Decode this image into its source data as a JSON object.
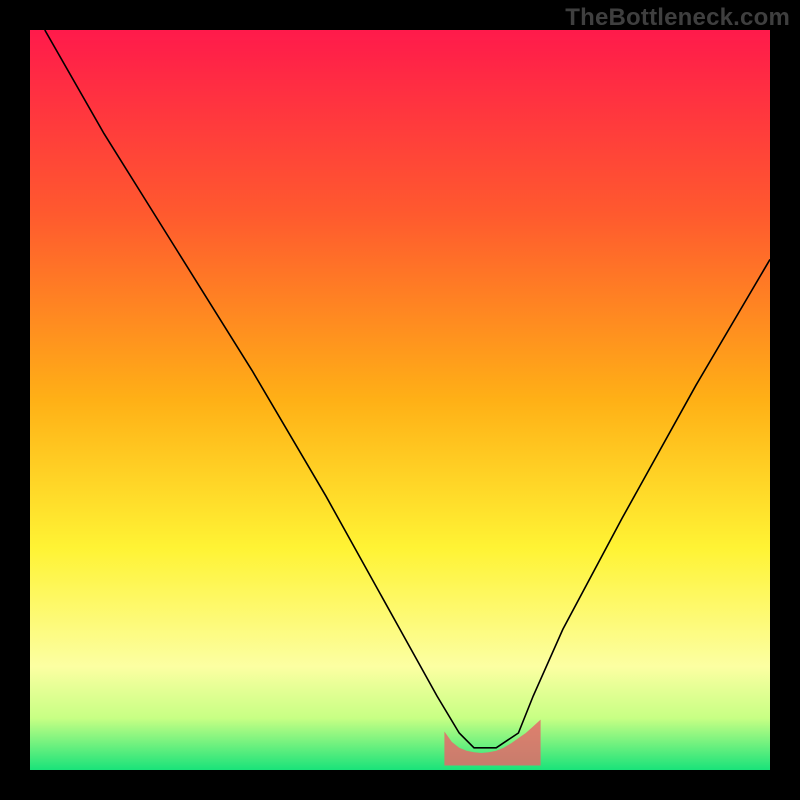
{
  "watermark": "TheBottleneck.com",
  "background_color": "#000000",
  "chart_data": {
    "type": "line",
    "title": "",
    "xlabel": "",
    "ylabel": "",
    "xlim": [
      0,
      100
    ],
    "ylim": [
      0,
      100
    ],
    "gradient_stops": [
      {
        "offset": 0.0,
        "color": "#ff1a4b"
      },
      {
        "offset": 0.25,
        "color": "#ff5a2e"
      },
      {
        "offset": 0.5,
        "color": "#ffb016"
      },
      {
        "offset": 0.7,
        "color": "#fff334"
      },
      {
        "offset": 0.86,
        "color": "#fcffa2"
      },
      {
        "offset": 0.93,
        "color": "#c7ff84"
      },
      {
        "offset": 1.0,
        "color": "#19e37a"
      }
    ],
    "series": [
      {
        "name": "curve",
        "color": "#000000",
        "width": 1.6,
        "x": [
          2,
          10,
          20,
          30,
          40,
          50,
          55,
          58,
          60,
          63,
          66,
          68,
          72,
          80,
          90,
          100
        ],
        "y": [
          100,
          86,
          70,
          54,
          37,
          19,
          10,
          5,
          3,
          3,
          5,
          10,
          19,
          34,
          52,
          69
        ]
      },
      {
        "name": "band-near-zero",
        "type": "area",
        "color": "#e46a6a",
        "x": [
          56,
          57,
          58,
          59,
          60,
          61,
          62,
          63,
          64,
          65,
          66,
          67,
          68,
          69
        ],
        "y": [
          5.2,
          3.8,
          3.0,
          2.6,
          2.4,
          2.3,
          2.4,
          2.6,
          3.0,
          3.6,
          4.3,
          5.0,
          5.9,
          6.8
        ]
      }
    ]
  }
}
